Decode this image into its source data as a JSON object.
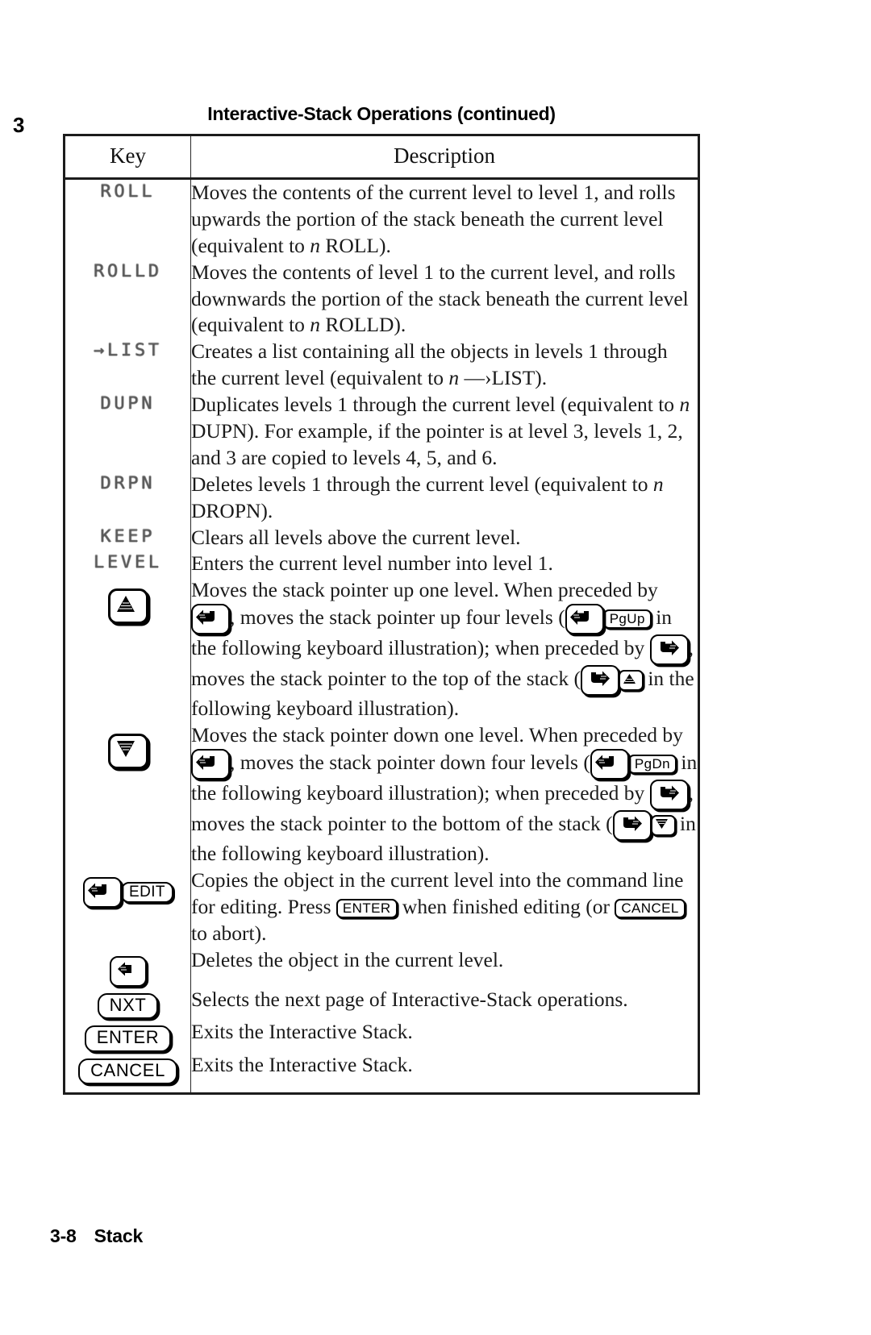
{
  "page": {
    "chapter_marker": "3",
    "title": "Interactive-Stack Operations (continued)",
    "footer_page": "3-8",
    "footer_label": "Stack"
  },
  "table": {
    "headers": {
      "key": "Key",
      "description": "Description"
    },
    "rows": [
      {
        "key_type": "lcd",
        "key_label": "ROLL",
        "description": "Moves the contents of the current level to level 1, and rolls upwards the portion of the stack beneath the current level (equivalent to n ROLL)."
      },
      {
        "key_type": "lcd",
        "key_label": "ROLLD",
        "description": "Moves the contents of level 1 to the current level, and rolls downwards the portion of the stack beneath the current level (equivalent to n ROLLD)."
      },
      {
        "key_type": "lcd",
        "key_label": "→LIST",
        "description": "Creates a list containing all the objects in levels 1 through the current level (equivalent to n →LIST)."
      },
      {
        "key_type": "lcd",
        "key_label": "DUPN",
        "description": "Duplicates levels 1 through the current level (equivalent to n DUPN). For example, if the pointer is at level 3, levels 1, 2, and 3 are copied to levels 4, 5, and 6."
      },
      {
        "key_type": "lcd",
        "key_label": "DRPN",
        "description": "Deletes levels 1 through the current level (equivalent to n DROPN)."
      },
      {
        "key_type": "lcd",
        "key_label": "KEEP",
        "description": "Clears all levels above the current level."
      },
      {
        "key_type": "lcd",
        "key_label": "LEVEL",
        "description": "Enters the current level number into level 1."
      },
      {
        "key_type": "cap-up-arrow",
        "key_label": "up-arrow-key",
        "description": "Moves the stack pointer up one level. When preceded by [left-shift], moves the stack pointer up four levels ([left-shift][PgUp] in the following keyboard illustration); when preceded by [right-shift], moves the stack pointer to the top of the stack ([right-shift][up-arrow] in the following keyboard illustration)."
      },
      {
        "key_type": "cap-down-arrow",
        "key_label": "down-arrow-key",
        "description": "Moves the stack pointer down one level. When preceded by [left-shift], moves the stack pointer down four levels ([left-shift][PgDn] in the following keyboard illustration); when preceded by [right-shift], moves the stack pointer to the bottom of the stack ([right-shift][down-arrow] in the following keyboard illustration)."
      },
      {
        "key_type": "cap-shift-edit",
        "key_label": "EDIT",
        "description": "Copies the object in the current level into the command line for editing. Press [ENTER] when finished editing (or [CANCEL] to abort)."
      },
      {
        "key_type": "cap-backspace",
        "key_label": "backspace-key",
        "description": "Deletes the object in the current level."
      },
      {
        "key_type": "cap-nxt",
        "key_label": "NXT",
        "description": "Selects the next page of Interactive-Stack operations."
      },
      {
        "key_type": "cap-enter",
        "key_label": "ENTER",
        "description": "Exits the Interactive Stack."
      },
      {
        "key_type": "cap-cancel",
        "key_label": "CANCEL",
        "description": "Exits the Interactive Stack."
      }
    ]
  },
  "inline_keys": {
    "pgup": "PgUp",
    "pgdn": "PgDn",
    "enter": "ENTER",
    "cancel": "CANCEL",
    "edit": "EDIT",
    "nxt": "NXT"
  },
  "icons": {
    "left_shift": "left-shift-icon",
    "right_shift": "right-shift-icon",
    "up_arrow": "up-arrow-icon",
    "down_arrow": "down-arrow-icon",
    "backspace": "backspace-icon"
  },
  "colors": {
    "ink": "#111111",
    "rule": "#1c1c1c",
    "lcd_text": "#5a5a5a",
    "page_bg": "#ffffff"
  }
}
